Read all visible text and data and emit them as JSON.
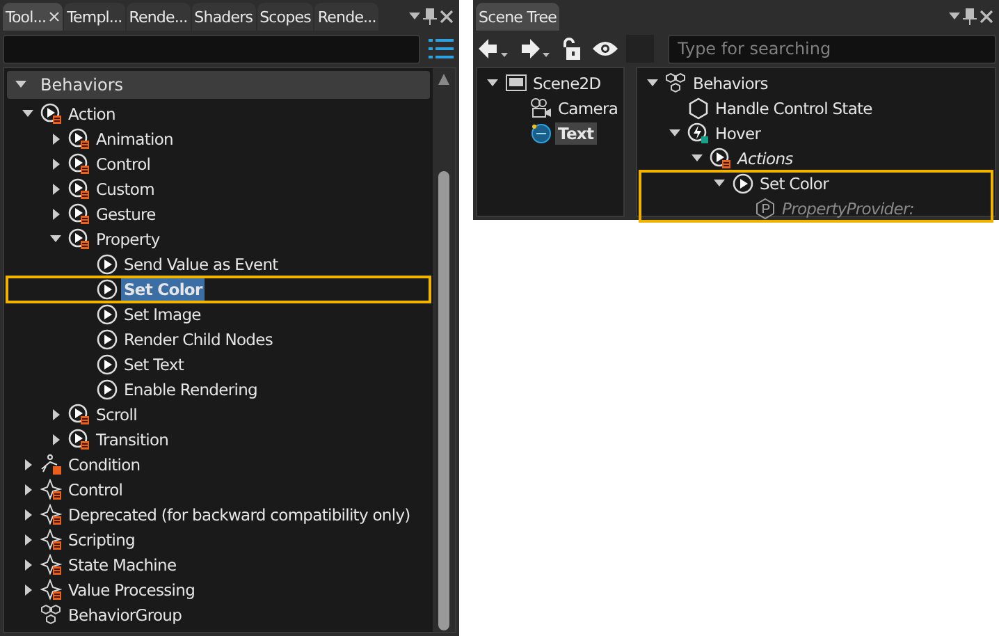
{
  "toolbox": {
    "tabs": [
      {
        "label": "Tool...",
        "selected": true,
        "closable": true
      },
      {
        "label": "Templ...",
        "selected": false,
        "closable": false
      },
      {
        "label": "Rende...",
        "selected": false,
        "closable": false
      },
      {
        "label": "Shaders",
        "selected": false,
        "closable": false
      },
      {
        "label": "Scopes",
        "selected": false,
        "closable": false
      },
      {
        "label": "Rende...",
        "selected": false,
        "closable": false
      }
    ],
    "group": {
      "label": "Behaviors",
      "expanded": true
    },
    "tree": [
      {
        "label": "Action",
        "kind": "action",
        "expanded": true,
        "selected": false,
        "highlighted": false,
        "children": [
          {
            "label": "Animation",
            "kind": "action",
            "expanded": false,
            "selected": false,
            "highlighted": false
          },
          {
            "label": "Control",
            "kind": "action",
            "expanded": false,
            "selected": false,
            "highlighted": false
          },
          {
            "label": "Custom",
            "kind": "action",
            "expanded": false,
            "selected": false,
            "highlighted": false
          },
          {
            "label": "Gesture",
            "kind": "action",
            "expanded": false,
            "selected": false,
            "highlighted": false
          },
          {
            "label": "Property",
            "kind": "action",
            "expanded": true,
            "selected": false,
            "highlighted": false,
            "children": [
              {
                "label": "Send Value as Event",
                "kind": "play",
                "selected": false,
                "highlighted": false
              },
              {
                "label": "Set Color",
                "kind": "play",
                "selected": true,
                "highlighted": true
              },
              {
                "label": "Set Image",
                "kind": "play",
                "selected": false,
                "highlighted": false
              },
              {
                "label": "Render Child Nodes",
                "kind": "play",
                "selected": false,
                "highlighted": false
              },
              {
                "label": "Set Text",
                "kind": "play",
                "selected": false,
                "highlighted": false
              },
              {
                "label": "Enable Rendering",
                "kind": "play",
                "selected": false,
                "highlighted": false
              }
            ]
          },
          {
            "label": "Scroll",
            "kind": "action",
            "expanded": false,
            "selected": false,
            "highlighted": false
          },
          {
            "label": "Transition",
            "kind": "action",
            "expanded": false,
            "selected": false,
            "highlighted": false
          }
        ]
      },
      {
        "label": "Condition",
        "kind": "condition",
        "expanded": false,
        "selected": false,
        "highlighted": false
      },
      {
        "label": "Control",
        "kind": "diamond",
        "expanded": false,
        "selected": false,
        "highlighted": false
      },
      {
        "label": "Deprecated (for backward compatibility only)",
        "kind": "diamond",
        "expanded": false,
        "selected": false,
        "highlighted": false
      },
      {
        "label": "Scripting",
        "kind": "diamond",
        "expanded": false,
        "selected": false,
        "highlighted": false
      },
      {
        "label": "State Machine",
        "kind": "diamond",
        "expanded": false,
        "selected": false,
        "highlighted": false
      },
      {
        "label": "Value Processing",
        "kind": "diamond",
        "expanded": false,
        "selected": false,
        "highlighted": false
      },
      {
        "label": "BehaviorGroup",
        "kind": "group",
        "selected": false,
        "highlighted": false
      }
    ]
  },
  "scene_tree": {
    "tab": {
      "label": "Scene Tree"
    },
    "search": {
      "placeholder": "Type for searching"
    },
    "nodes": [
      {
        "label": "Scene2D",
        "kind": "scene",
        "expanded": true,
        "selected": false,
        "children": [
          {
            "label": "Camera",
            "kind": "camera",
            "selected": false
          },
          {
            "label": "Text",
            "kind": "text",
            "selected": true
          }
        ]
      }
    ],
    "behaviors": [
      {
        "label": "Behaviors",
        "kind": "group",
        "expanded": true,
        "italic": false,
        "dimmed": false,
        "highlighted": false,
        "children": [
          {
            "label": "Handle Control State",
            "kind": "hexagon",
            "italic": false,
            "dimmed": false,
            "highlighted": false
          },
          {
            "label": "Hover",
            "kind": "trigger",
            "expanded": true,
            "italic": false,
            "dimmed": false,
            "highlighted": false,
            "children": [
              {
                "label": "Actions",
                "kind": "action",
                "expanded": true,
                "italic": true,
                "dimmed": false,
                "highlighted": false,
                "children": [
                  {
                    "label": "Set Color",
                    "kind": "play",
                    "expanded": true,
                    "italic": false,
                    "dimmed": false,
                    "highlighted": true,
                    "children": [
                      {
                        "label": "PropertyProvider:",
                        "kind": "property",
                        "italic": true,
                        "dimmed": true,
                        "highlighted": false
                      }
                    ]
                  }
                ]
              }
            ]
          }
        ]
      }
    ]
  }
}
